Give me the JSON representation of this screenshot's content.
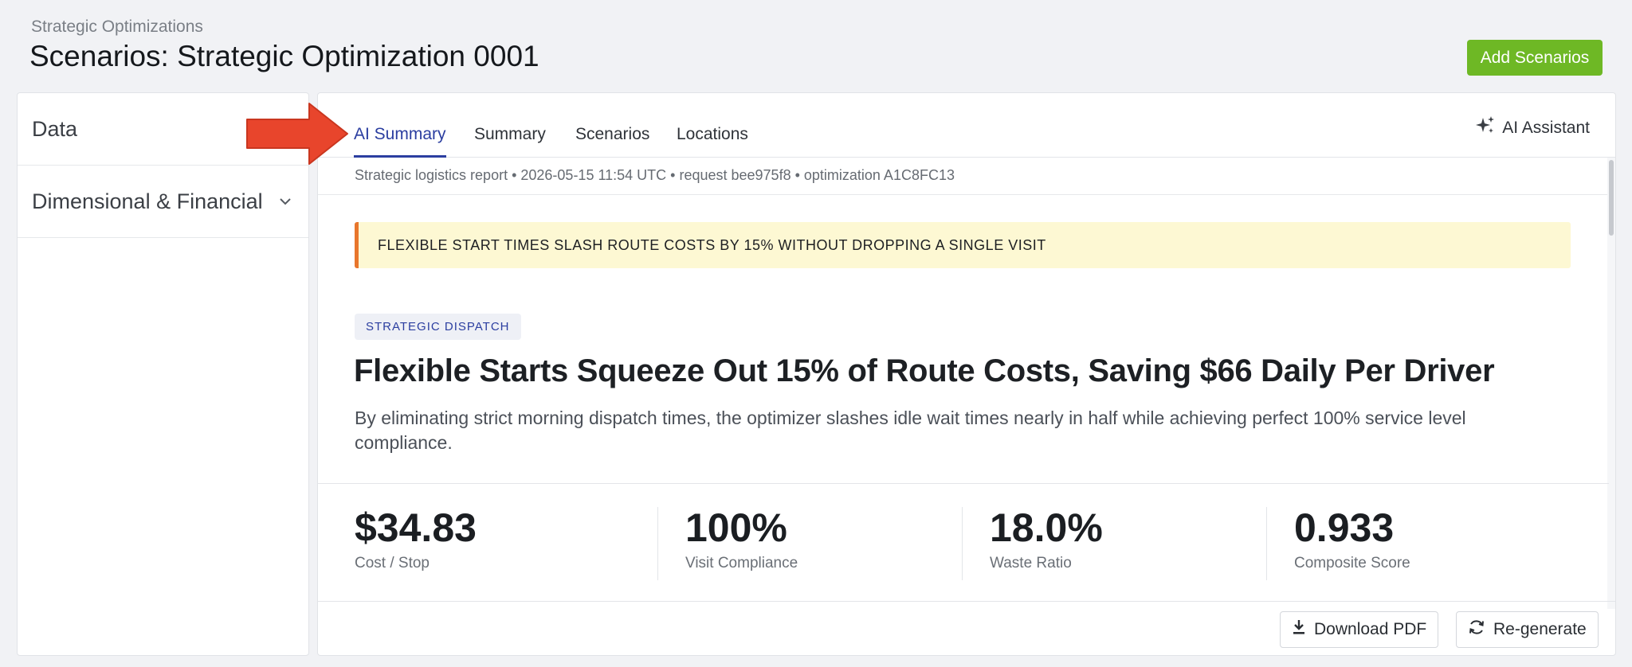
{
  "header": {
    "breadcrumb": "Strategic Optimizations",
    "title": "Scenarios: Strategic Optimization 0001",
    "add_button": "Add Scenarios"
  },
  "sidebar": {
    "items": [
      {
        "label": "Data"
      },
      {
        "label": "Dimensional & Financial",
        "icon": "chevron-down-icon"
      }
    ]
  },
  "tabs": [
    {
      "label": "AI Summary",
      "active": true
    },
    {
      "label": "Summary"
    },
    {
      "label": "Scenarios"
    },
    {
      "label": "Locations"
    }
  ],
  "ai_assistant": {
    "label": "AI Assistant",
    "icon": "sparkle-icon"
  },
  "report": {
    "meta": "Strategic logistics report • 2026-05-15 11:54 UTC • request bee975f8 • optimization A1C8FC13",
    "banner": "FLEXIBLE START TIMES SLASH ROUTE COSTS BY 15% WITHOUT DROPPING A SINGLE VISIT",
    "tag": "STRATEGIC DISPATCH",
    "headline": "Flexible Starts Squeeze Out 15% of Route Costs, Saving $66 Daily Per Driver",
    "subhead": "By eliminating strict morning dispatch times, the optimizer slashes idle wait times nearly in half while achieving perfect 100% service level compliance.",
    "stats": [
      {
        "value": "$34.83",
        "label": "Cost / Stop"
      },
      {
        "value": "100%",
        "label": "Visit Compliance"
      },
      {
        "value": "18.0%",
        "label": "Waste Ratio"
      },
      {
        "value": "0.933",
        "label": "Composite Score"
      }
    ]
  },
  "footer": {
    "download_label": "Download PDF",
    "regenerate_label": "Re-generate"
  },
  "colors": {
    "accent": "#2b3ea0",
    "add_button": "#6eb825",
    "banner_bg": "#fdf8d3",
    "banner_border": "#e8762c",
    "annotation_arrow": "#e8452c"
  }
}
